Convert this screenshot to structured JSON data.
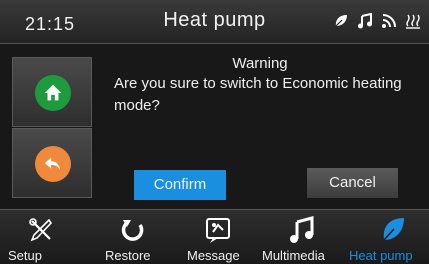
{
  "status_bar": {
    "time": "21:15",
    "title": "Heat pump",
    "icons": [
      "leaf-icon",
      "music-note-icon",
      "rss-icon",
      "heat-waves-icon"
    ]
  },
  "side": {
    "home_icon": "home-icon",
    "back_icon": "back-arrow-icon"
  },
  "dialog": {
    "title": "Warning",
    "message": "Are you sure to switch to Economic heating mode?",
    "confirm_label": "Confirm",
    "cancel_label": "Cancel"
  },
  "nav": {
    "items": [
      {
        "label": "Setup",
        "icon": "tools-icon"
      },
      {
        "label": "Restore",
        "icon": "restore-icon"
      },
      {
        "label": "Message",
        "icon": "message-icon"
      },
      {
        "label": "Multimedia",
        "icon": "music-note-icon"
      },
      {
        "label": "Heat pump",
        "icon": "leaf-icon"
      }
    ],
    "active_color": "#1a8fe0"
  },
  "colors": {
    "confirm": "#1a8fe0",
    "home": "#1e9b3c",
    "back": "#ef8a3c"
  }
}
